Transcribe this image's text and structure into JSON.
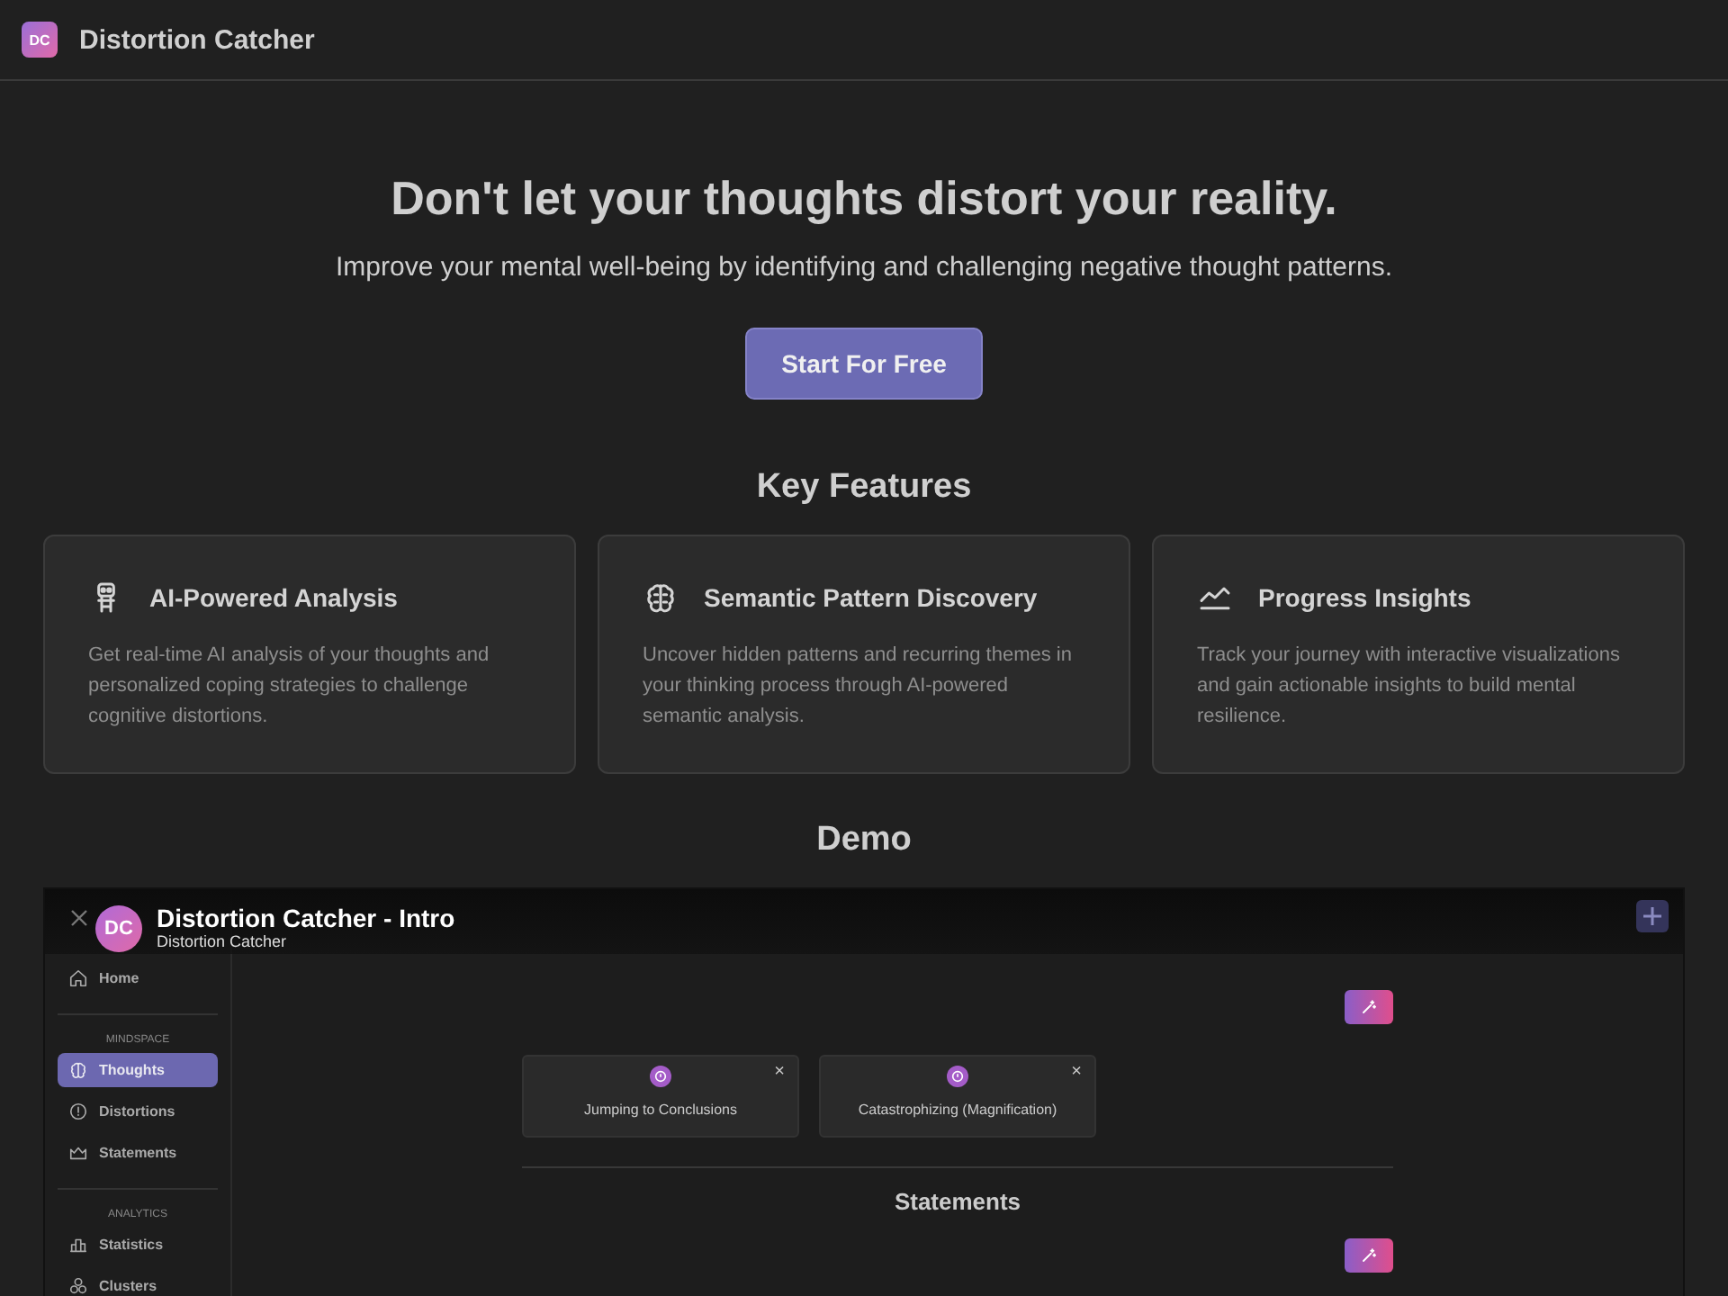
{
  "header": {
    "logo": "DC",
    "title": "Distortion Catcher"
  },
  "hero": {
    "title": "Don't let your thoughts distort your reality.",
    "subtitle": "Improve your mental well-being by identifying and challenging negative thought patterns.",
    "button": "Start For Free"
  },
  "features": {
    "title": "Key Features",
    "items": [
      {
        "title": "AI-Powered Analysis",
        "description": "Get real-time AI analysis of your thoughts and personalized coping strategies to challenge cognitive distortions."
      },
      {
        "title": "Semantic Pattern Discovery",
        "description": "Uncover hidden patterns and recurring themes in your thinking process through AI-powered semantic analysis."
      },
      {
        "title": "Progress Insights",
        "description": "Track your journey with interactive visualizations and gain actionable insights to build mental resilience."
      }
    ]
  },
  "demo": {
    "title": "Demo",
    "video": {
      "title": "Distortion Catcher - Intro",
      "channel": "Distortion Catcher",
      "avatar": "DC",
      "app": {
        "sidebar": [
          {
            "kind": "item",
            "label": "Home",
            "selected": false
          },
          {
            "kind": "section",
            "label": "MINDSPACE"
          },
          {
            "kind": "item",
            "label": "Thoughts",
            "selected": true
          },
          {
            "kind": "item",
            "label": "Distortions",
            "selected": false
          },
          {
            "kind": "item",
            "label": "Statements",
            "selected": false
          },
          {
            "kind": "section",
            "label": "ANALYTICS"
          },
          {
            "kind": "item",
            "label": "Statistics",
            "selected": false
          },
          {
            "kind": "item",
            "label": "Clusters",
            "selected": false
          }
        ],
        "distortions": [
          {
            "label": "Jumping to Conclusions",
            "close": "×"
          },
          {
            "label": "Catastrophizing (Magnification)",
            "close": "×"
          }
        ],
        "section_title": "Statements"
      }
    }
  }
}
